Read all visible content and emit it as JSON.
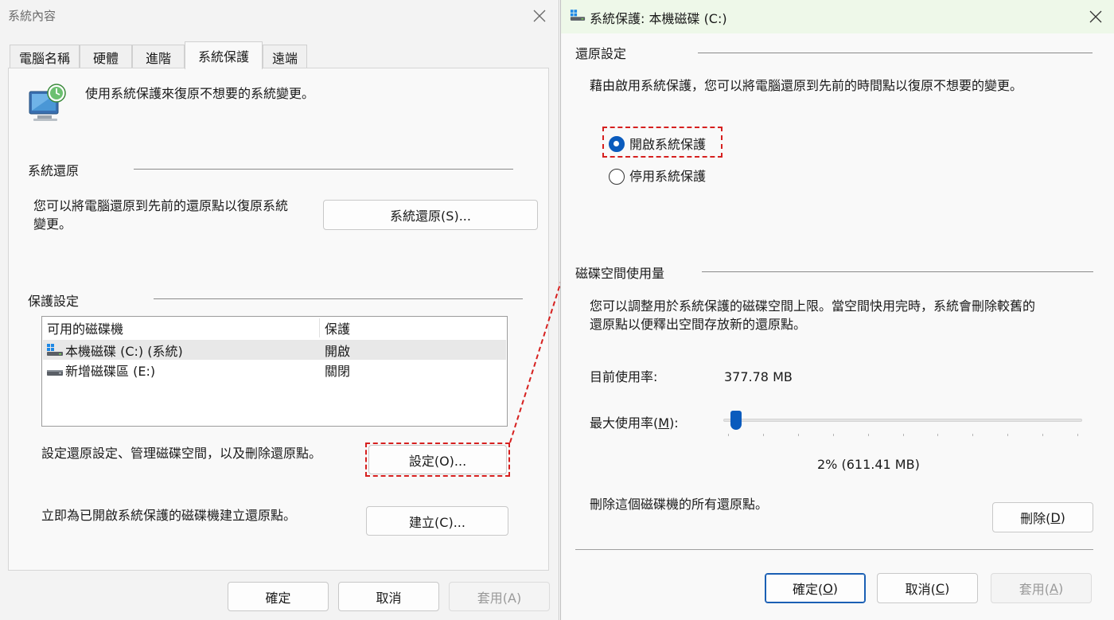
{
  "left": {
    "title": "系統內容",
    "tabs": [
      "電腦名稱",
      "硬體",
      "進階",
      "系統保護",
      "遠端"
    ],
    "active_tab": "系統保護",
    "intro": "使用系統保護來復原不想要的系統變更。",
    "restore_section": "系統還原",
    "restore_desc_line1": "您可以將電腦還原到先前的還原點以復原系統",
    "restore_desc_line2": "變更。",
    "restore_button": "系統還原(S)...",
    "protection_section": "保護設定",
    "list_headers": [
      "可用的磁碟機",
      "保護"
    ],
    "drives": [
      {
        "name": "本機磁碟 (C:) (系統)",
        "status": "開啟"
      },
      {
        "name": "新增磁碟區 (E:)",
        "status": "關閉"
      }
    ],
    "config_desc": "設定還原設定、管理磁碟空間，以及刪除還原點。",
    "config_button": "設定(O)...",
    "create_desc": "立即為已開啟系統保護的磁碟機建立還原點。",
    "create_button": "建立(C)...",
    "ok": "確定",
    "cancel": "取消",
    "apply": "套用(A)"
  },
  "right": {
    "title": "系統保護: 本機磁碟 (C:)",
    "restore_settings": "還原設定",
    "restore_desc": "藉由啟用系統保護，您可以將電腦還原到先前的時間點以復原不想要的變更。",
    "radio_on": "開啟系統保護",
    "radio_off": "停用系統保護",
    "radio_selected": "開啟系統保護",
    "disk_section": "磁碟空間使用量",
    "disk_desc_line1": "您可以調整用於系統保護的磁碟空間上限。當空間快用完時，系統會刪除較舊的",
    "disk_desc_line2": "還原點以便釋出空間存放新的還原點。",
    "current_label": "目前使用率:",
    "current_value": "377.78 MB",
    "max_label_pre": "最大使用率(",
    "max_label_key": "M",
    "max_label_post": "):",
    "max_percent": 2,
    "max_value": "2% (611.41 MB)",
    "delete_desc": "刪除這個磁碟機的所有還原點。",
    "delete_pre": "刪除(",
    "delete_key": "D",
    "delete_post": ")",
    "ok_pre": "確定(",
    "ok_key": "O",
    "ok_post": ")",
    "cancel_pre": "取消(",
    "cancel_key": "C",
    "cancel_post": ")",
    "apply_pre": "套用(",
    "apply_key": "A",
    "apply_post": ")"
  },
  "colors": {
    "accent": "#0a5bbd",
    "highlight": "#d6201f"
  }
}
